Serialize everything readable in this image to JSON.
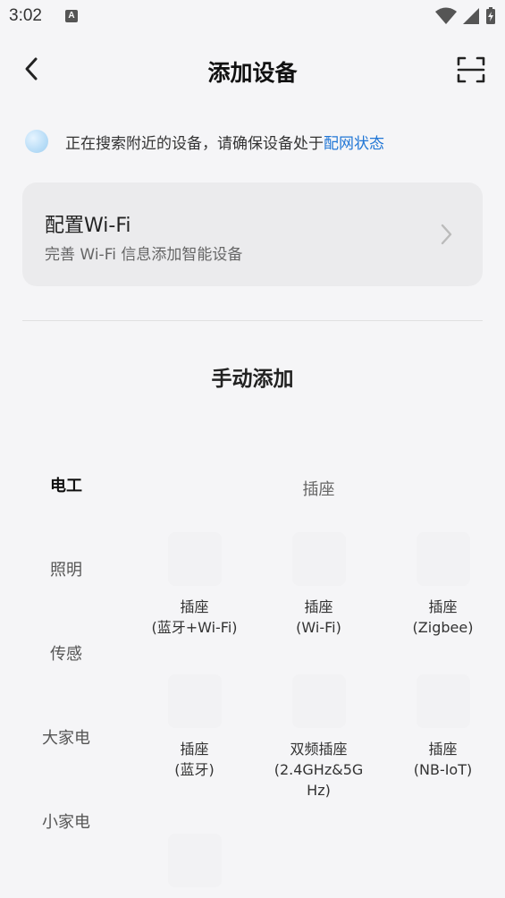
{
  "status_bar": {
    "time": "3:02",
    "app_icon_letter": "A"
  },
  "header": {
    "title": "添加设备"
  },
  "search": {
    "text": "正在搜索附近的设备，请确保设备处于",
    "link": "配网状态"
  },
  "wifi_card": {
    "title": "配置Wi-Fi",
    "subtitle": "完善 Wi-Fi 信息添加智能设备"
  },
  "manual": {
    "title": "手动添加"
  },
  "categories": [
    "电工",
    "照明",
    "传感",
    "大家电",
    "小家电"
  ],
  "group": {
    "title": "插座"
  },
  "devices": [
    {
      "line1": "插座",
      "line2": "(蓝牙+Wi-Fi)"
    },
    {
      "line1": "插座",
      "line2": "(Wi-Fi)"
    },
    {
      "line1": "插座",
      "line2": "(Zigbee)"
    },
    {
      "line1": "插座",
      "line2": "(蓝牙)"
    },
    {
      "line1": "双频插座",
      "line2": "(2.4GHz&5G",
      "line3": "Hz)"
    },
    {
      "line1": "插座",
      "line2": "(NB-IoT)"
    }
  ],
  "colors": {
    "link": "#2277d6",
    "background": "#f5f5f7",
    "card": "#ebebed"
  }
}
